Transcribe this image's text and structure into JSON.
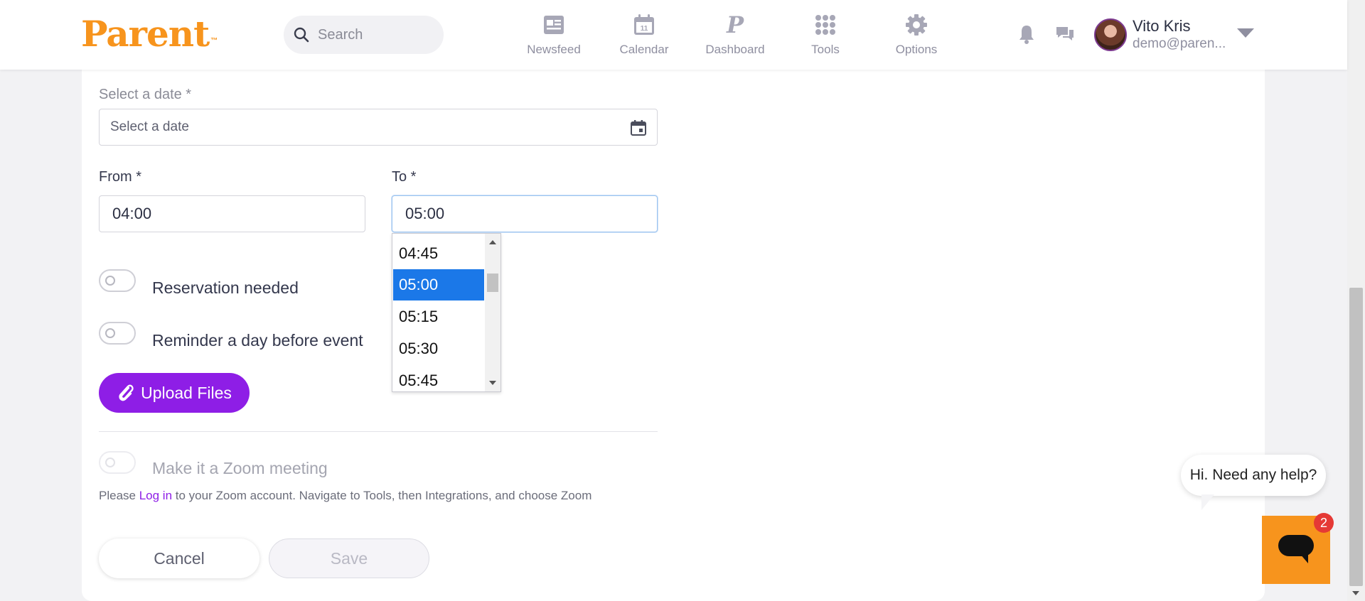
{
  "header": {
    "logo_text": "Parent",
    "logo_tm": "™",
    "search": {
      "placeholder": "Search"
    },
    "nav": [
      {
        "label": "Newsfeed",
        "icon": "newsfeed-icon"
      },
      {
        "label": "Calendar",
        "icon": "calendar-icon"
      },
      {
        "label": "Dashboard",
        "icon": "dashboard-icon"
      },
      {
        "label": "Tools",
        "icon": "tools-icon"
      },
      {
        "label": "Options",
        "icon": "gear-icon"
      }
    ],
    "user": {
      "name": "Vito Kris",
      "email": "demo@paren..."
    }
  },
  "form": {
    "date_label": "Select a date *",
    "date_placeholder": "Select a date",
    "from_label": "From *",
    "from_value": "04:00",
    "to_label": "To *",
    "to_value": "05:00",
    "reservation_label": "Reservation needed",
    "reminder_label": "Reminder a day before event",
    "upload_label": "Upload Files",
    "zoom_label": "Make it a Zoom meeting",
    "zoom_note_prefix": "Please",
    "zoom_note_link": "Log in",
    "zoom_note_suffix": "to your Zoom account. Navigate to Tools, then Integrations, and choose Zoom",
    "cancel_label": "Cancel",
    "save_label": "Save"
  },
  "time_dropdown": {
    "options": [
      "04:45",
      "05:00",
      "05:15",
      "05:30",
      "05:45"
    ],
    "selected": "05:00"
  },
  "help": {
    "bubble_text": "Hi. Need any help?",
    "badge_count": "2"
  },
  "colors": {
    "brand_orange": "#f7941d",
    "accent_purple": "#8e1ee6",
    "selection_blue": "#1b78e8",
    "badge_red": "#e53935"
  }
}
